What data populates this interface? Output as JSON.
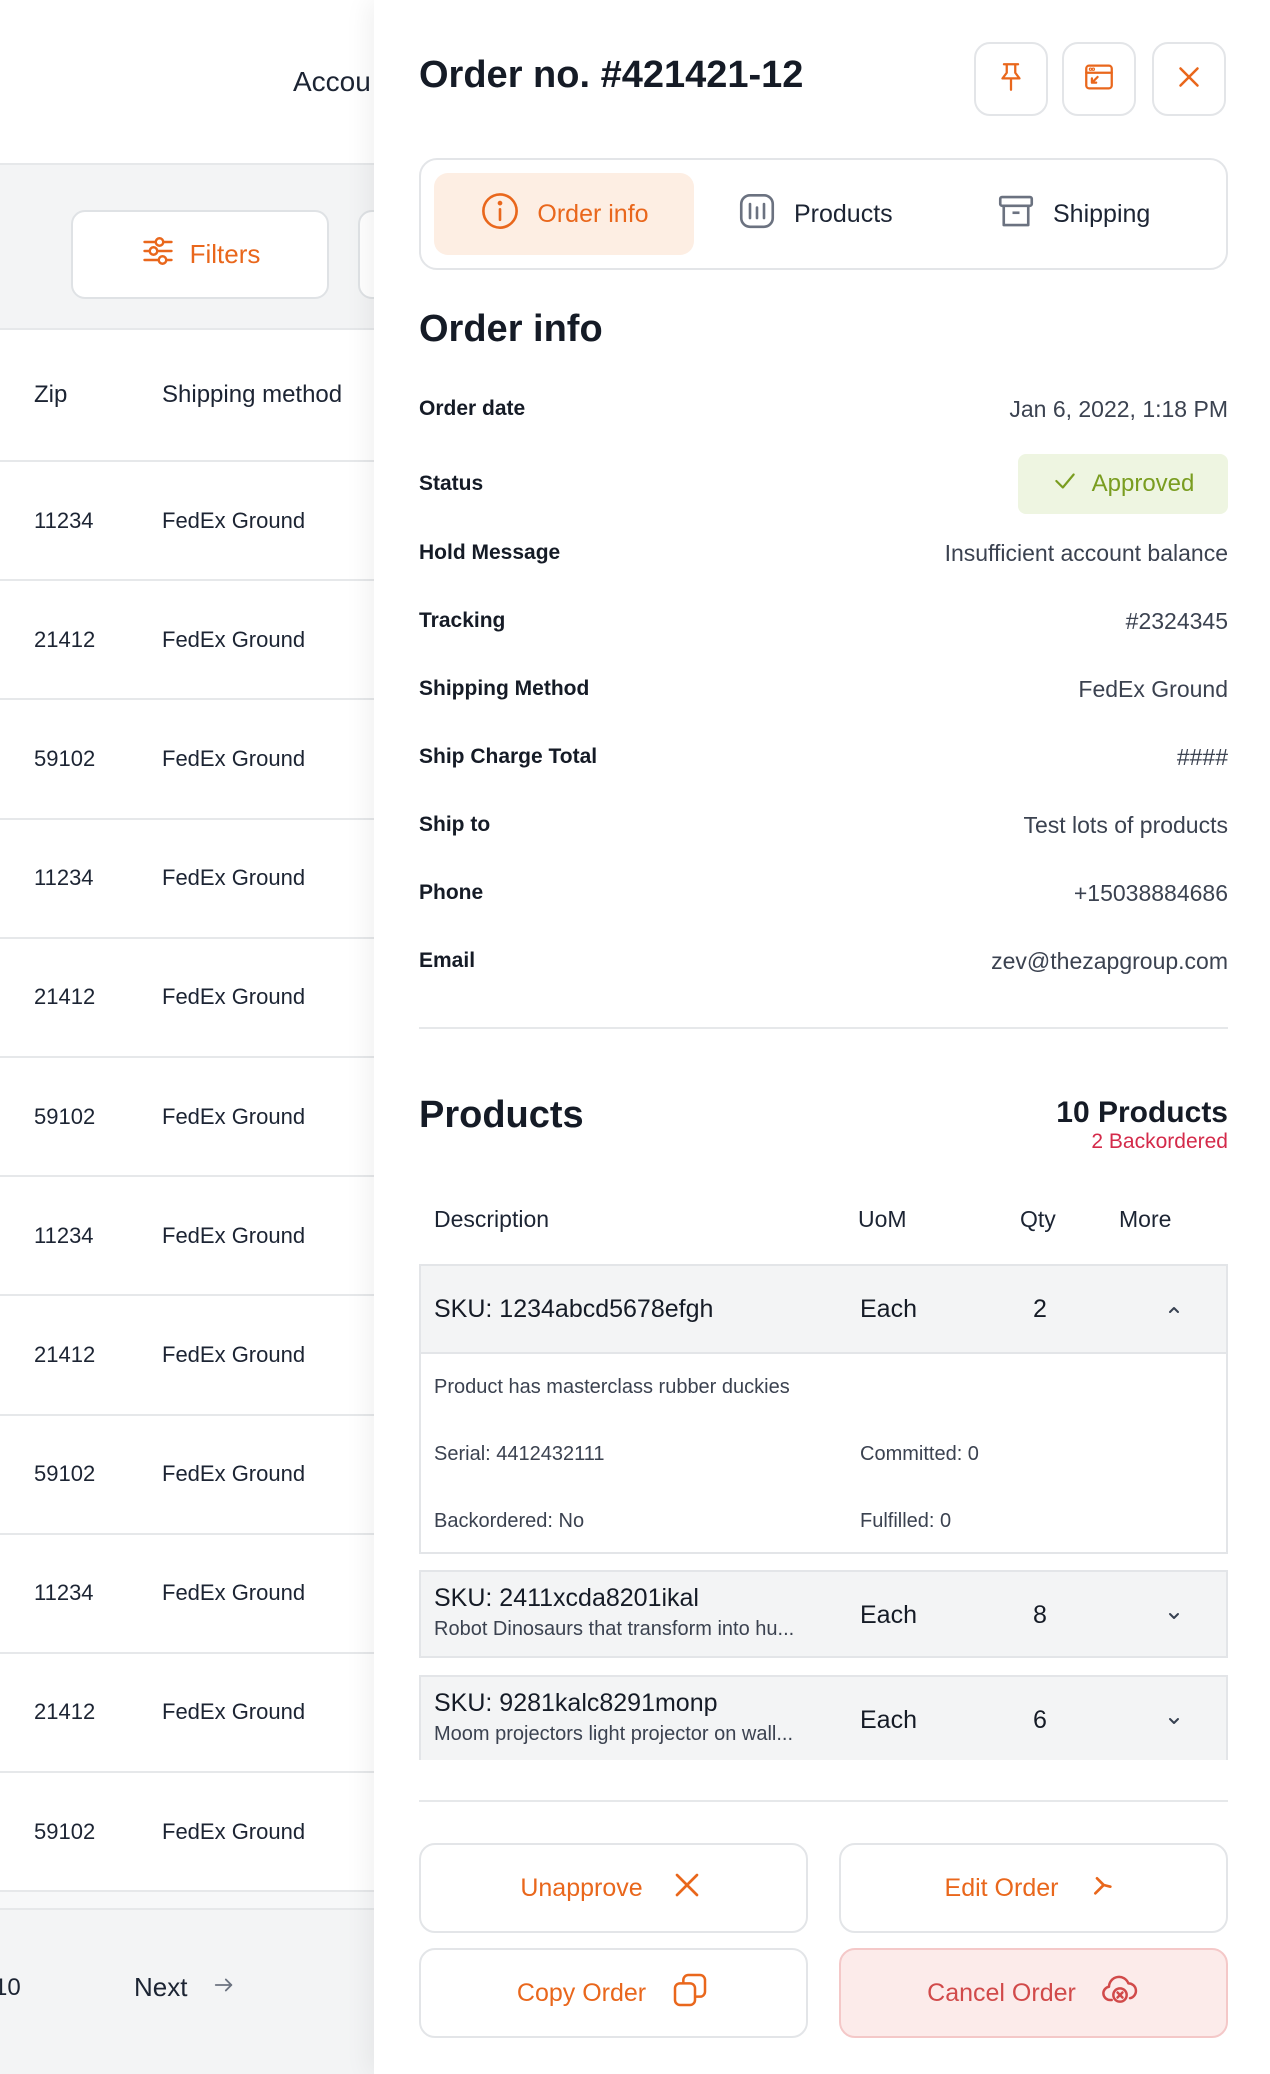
{
  "background": {
    "account_label": "Accou",
    "filters_label": "Filters",
    "columns": {
      "zip": "Zip",
      "shipping_method": "Shipping method"
    },
    "rows": [
      {
        "zip": "11234",
        "shipping": "FedEx Ground"
      },
      {
        "zip": "21412",
        "shipping": "FedEx Ground"
      },
      {
        "zip": "59102",
        "shipping": "FedEx Ground"
      },
      {
        "zip": "11234",
        "shipping": "FedEx Ground"
      },
      {
        "zip": "21412",
        "shipping": "FedEx Ground"
      },
      {
        "zip": "59102",
        "shipping": "FedEx Ground"
      },
      {
        "zip": "11234",
        "shipping": "FedEx Ground"
      },
      {
        "zip": "21412",
        "shipping": "FedEx Ground"
      },
      {
        "zip": "59102",
        "shipping": "FedEx Ground"
      },
      {
        "zip": "11234",
        "shipping": "FedEx Ground"
      },
      {
        "zip": "21412",
        "shipping": "FedEx Ground"
      },
      {
        "zip": "59102",
        "shipping": "FedEx Ground"
      }
    ],
    "pagination": {
      "page_fragment": "10",
      "next_label": "Next"
    }
  },
  "drawer": {
    "title": "Order no. #421421-12",
    "header_icons": [
      "pin-icon",
      "window-minimize-icon",
      "close-icon"
    ],
    "tabs": [
      {
        "label": "Order info",
        "icon": "info-icon",
        "active": true
      },
      {
        "label": "Products",
        "icon": "bar-chart-icon",
        "active": false
      },
      {
        "label": "Shipping",
        "icon": "archive-box-icon",
        "active": false
      }
    ],
    "order_info": {
      "title": "Order info",
      "order_date_label": "Order date",
      "order_date": "Jan 6, 2022, 1:18 PM",
      "status_label": "Status",
      "status": "Approved",
      "hold_message_label": "Hold Message",
      "hold_message": "Insufficient account balance",
      "tracking_label": "Tracking",
      "tracking": "#2324345",
      "shipping_method_label": "Shipping Method",
      "shipping_method": "FedEx Ground",
      "ship_charge_label": "Ship Charge Total",
      "ship_charge": "####",
      "ship_to_label": "Ship to",
      "ship_to": "Test lots of products",
      "phone_label": "Phone",
      "phone": "+15038884686",
      "email_label": "Email",
      "email": "zev@thezapgroup.com"
    },
    "products": {
      "title": "Products",
      "count": "10 Products",
      "backordered": "2 Backordered",
      "columns": {
        "description": "Description",
        "uom": "UoM",
        "qty": "Qty",
        "more": "More"
      },
      "items": [
        {
          "sku": "SKU: 1234abcd5678efgh",
          "uom": "Each",
          "qty": "2",
          "expanded": true,
          "details": {
            "description": "Product has masterclass rubber duckies",
            "serial": "Serial: 4412432111",
            "committed": "Committed: 0",
            "backordered": "Backordered: No",
            "fulfilled": "Fulfilled: 0"
          }
        },
        {
          "sku": "SKU: 2411xcda8201ikal",
          "description": "Robot Dinosaurs that transform into hu...",
          "uom": "Each",
          "qty": "8",
          "expanded": false
        },
        {
          "sku": "SKU: 9281kalc8291monp",
          "description": "Moom projectors light projector on wall...",
          "uom": "Each",
          "qty": "6",
          "expanded": false
        }
      ]
    },
    "actions": {
      "unapprove": "Unapprove",
      "edit": "Edit Order",
      "copy": "Copy Order",
      "cancel": "Cancel Order"
    },
    "colors": {
      "accent": "#e9671c",
      "approved": "#7a9d20",
      "danger": "#d42a4a"
    }
  }
}
